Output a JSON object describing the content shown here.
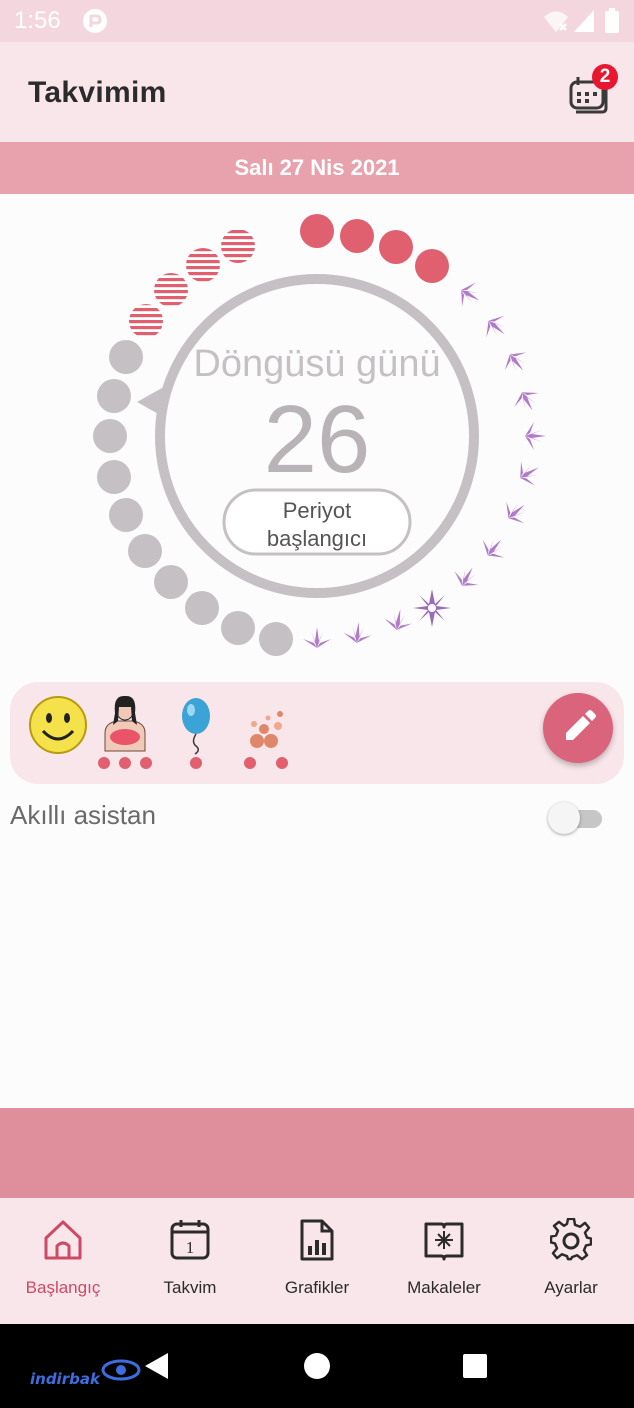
{
  "status_bar": {
    "time": "1:56",
    "icons": [
      "app-notification-icon",
      "wifi-icon",
      "signal-icon",
      "battery-icon"
    ]
  },
  "app_bar": {
    "title": "Takvimim",
    "notification_count": "2"
  },
  "date_banner": {
    "text": "Salı 27 Nis 2021"
  },
  "cycle": {
    "label": "Döngüsü günü",
    "day": "26",
    "period_button_line1": "Periyot",
    "period_button_line2": "başlangıcı"
  },
  "symptoms": {
    "items": [
      {
        "name": "smiley-mood-icon",
        "dots": 0
      },
      {
        "name": "breast-pain-icon",
        "dots": 3
      },
      {
        "name": "balloon-bloating-icon",
        "dots": 1
      },
      {
        "name": "acne-icon",
        "dots": 2
      }
    ]
  },
  "assistant": {
    "label": "Akıllı asistan",
    "enabled": false
  },
  "bottom_nav": {
    "items": [
      {
        "label": "Başlangıç",
        "icon": "home-icon",
        "active": true
      },
      {
        "label": "Takvim",
        "icon": "calendar-icon",
        "active": false
      },
      {
        "label": "Grafikler",
        "icon": "chart-icon",
        "active": false
      },
      {
        "label": "Makaleler",
        "icon": "articles-icon",
        "active": false
      },
      {
        "label": "Ayarlar",
        "icon": "settings-icon",
        "active": false
      }
    ]
  },
  "watermark": "indirbak",
  "colors": {
    "accent": "#d9647b",
    "period_dot": "#e06070",
    "fertile_leaf": "#b07cc8",
    "past_dot": "#c5c0c3",
    "banner": "#e8a2ad"
  }
}
